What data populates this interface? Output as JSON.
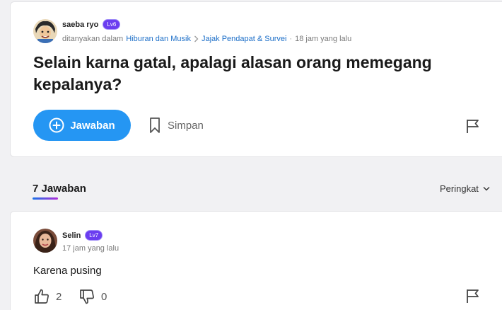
{
  "question": {
    "author": "saeba ryo",
    "level": "Lv6",
    "asked_in_label": "ditanyakan dalam",
    "category": "Hiburan dan Musik",
    "subcategory": "Jajak Pendapat & Survei",
    "time": "18 jam yang lalu",
    "title": "Selain karna gatal, apalagi alasan orang memegang kepalanya?",
    "answer_button": "Jawaban",
    "save_button": "Simpan"
  },
  "answers_section": {
    "count_label": "7 Jawaban",
    "sort_label": "Peringkat"
  },
  "answer": {
    "author": "Selin",
    "level": "Lv7",
    "time": "17 jam yang lalu",
    "text": "Karena pusing",
    "likes": "2",
    "dislikes": "0"
  },
  "colors": {
    "accent": "#2596f3",
    "level_badge": "#6b3df0",
    "link": "#1d6fc8"
  },
  "icons": [
    "avatar-image",
    "chevron-right-icon",
    "plus-circle-icon",
    "bookmark-icon",
    "flag-icon",
    "chevron-down-icon",
    "thumbs-up-icon",
    "thumbs-down-icon"
  ]
}
